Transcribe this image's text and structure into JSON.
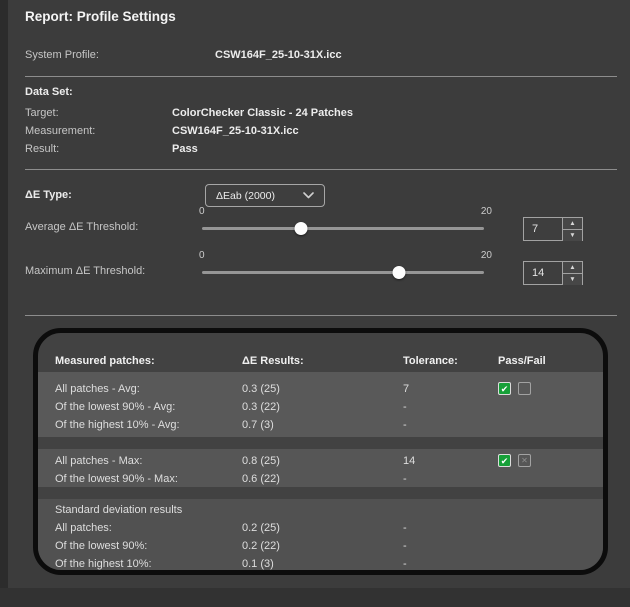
{
  "header": {
    "title": "Report: Profile Settings"
  },
  "system_profile": {
    "label": "System Profile:",
    "value": "CSW164F_25-10-31X.icc"
  },
  "data_set": {
    "heading": "Data Set:",
    "rows": [
      {
        "label": "Target:",
        "value": "ColorChecker Classic - 24 Patches"
      },
      {
        "label": "Measurement:",
        "value": "CSW164F_25-10-31X.icc"
      },
      {
        "label": "Result:",
        "value": "Pass"
      }
    ]
  },
  "de_type": {
    "label": "ΔE Type:",
    "selected": "ΔEab (2000)"
  },
  "sliders": [
    {
      "label": "Average ΔE Threshold:",
      "min": "0",
      "max": "20",
      "value": "7"
    },
    {
      "label": "Maximum ΔE Threshold:",
      "min": "0",
      "max": "20",
      "value": "14"
    }
  ],
  "results_table": {
    "header": {
      "measured": "Measured patches:",
      "de_results": "ΔE Results:",
      "tolerance": "Tolerance:",
      "pass_fail": "Pass/Fail"
    },
    "groups": [
      {
        "rows": [
          {
            "label": "All patches - Avg:",
            "result": "0.3 (25)",
            "tolerance": "7",
            "pass": true,
            "fail": false,
            "fail_glyph": ""
          },
          {
            "label": "Of the lowest 90% - Avg:",
            "result": "0.3 (22)",
            "tolerance": "-"
          },
          {
            "label": "Of the highest 10% - Avg:",
            "result": "0.7 (3)",
            "tolerance": "-"
          }
        ]
      },
      {
        "rows": [
          {
            "label": "All patches - Max:",
            "result": "0.8 (25)",
            "tolerance": "14",
            "pass": true,
            "fail": false,
            "fail_glyph": "✕"
          },
          {
            "label": "Of the lowest 90% - Max:",
            "result": "0.6 (22)",
            "tolerance": "-"
          }
        ]
      },
      {
        "rows": [
          {
            "label": "Standard deviation results",
            "result": "",
            "tolerance": ""
          },
          {
            "label": "All patches:",
            "result": "0.2 (25)",
            "tolerance": "-"
          },
          {
            "label": "Of the lowest 90%:",
            "result": "0.2 (22)",
            "tolerance": "-"
          },
          {
            "label": "Of the highest 10%:",
            "result": "0.1 (3)",
            "tolerance": "-"
          }
        ]
      }
    ]
  },
  "icons": {
    "dropdown": "chevron-down",
    "check_glyph": "✔",
    "spin_up_glyph": "▲",
    "spin_down_glyph": "▼"
  },
  "colors": {
    "pass_green": "#16a038",
    "background": "#3c3c3c",
    "band": "#595959"
  }
}
